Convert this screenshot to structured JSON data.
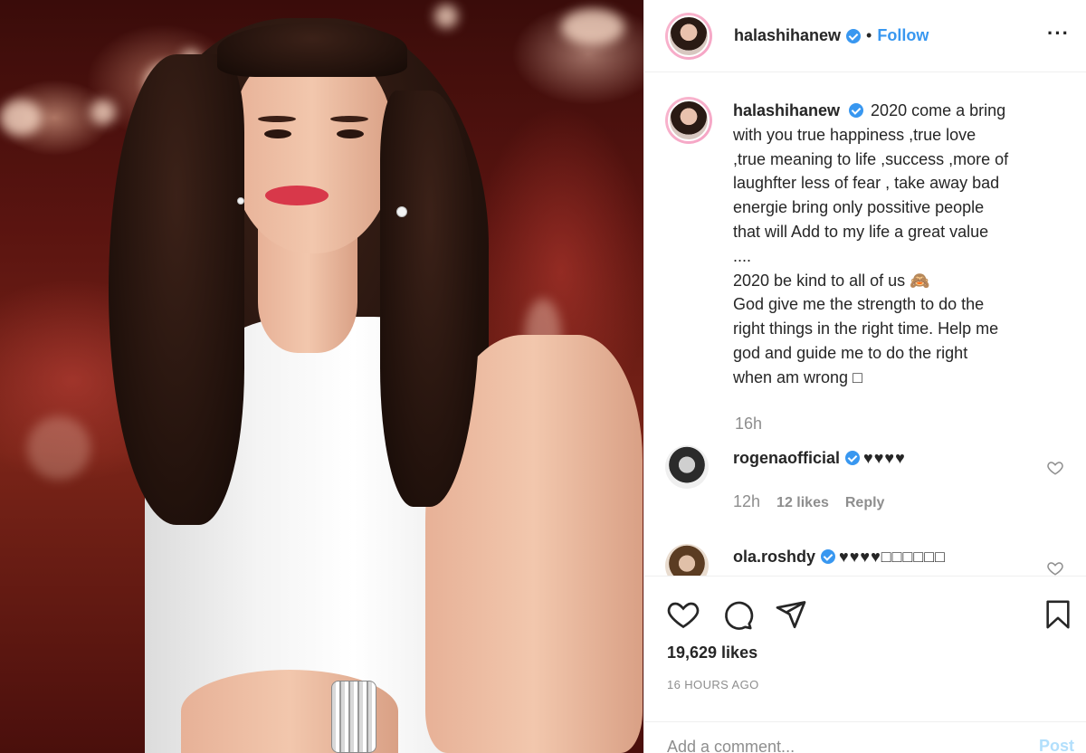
{
  "post": {
    "username": "halashihanew",
    "follow_label": "Follow",
    "separator": "•",
    "more_label": "···"
  },
  "caption": {
    "username": "halashihanew",
    "lines": [
      "2020 come a bring",
      "with you true happiness ,true love",
      ",true meaning to life ,success ,more of",
      "laughfter less of fear , take away bad",
      "energie bring only possitive people",
      "that will Add to my life a great value",
      "....",
      "2020 be kind to all of us 🙈",
      "God give me the strength to do the",
      "right things in the right time. Help me",
      "god and guide me to do the right",
      "when am wrong □"
    ],
    "time": "16h"
  },
  "comments": [
    {
      "username": "rogenaofficial",
      "text": "♥♥♥♥",
      "time": "12h",
      "likes": "12 likes",
      "reply": "Reply"
    },
    {
      "username": "ola.roshdy",
      "text": "♥♥♥♥□□□□□□"
    }
  ],
  "actions": {
    "likes": "19,629 likes",
    "timestamp": "16 HOURS AGO",
    "add_comment_placeholder": "Add a comment...",
    "post_label": "Post"
  },
  "icons": [
    "heart-icon",
    "comment-icon",
    "share-icon",
    "bookmark-icon",
    "verified-badge-icon",
    "more-options-icon"
  ],
  "colors": {
    "accent": "#3897f0",
    "muted": "#8e8e8e",
    "text": "#262626",
    "post_disabled": "#b2dffc"
  }
}
